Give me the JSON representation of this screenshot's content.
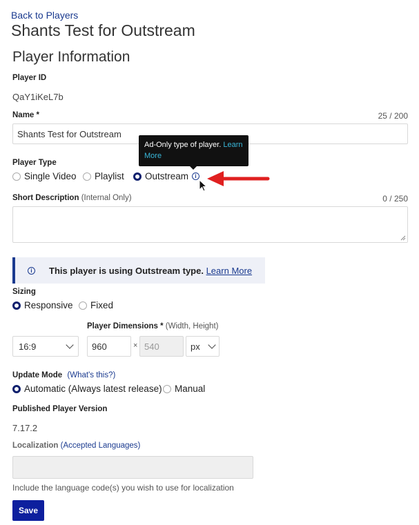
{
  "nav": {
    "back_label": "Back to Players"
  },
  "page": {
    "title": "Shants Test for Outstream",
    "section_title": "Player Information"
  },
  "player_id": {
    "label": "Player ID",
    "value": "QaY1iKeL7b"
  },
  "name": {
    "label": "Name *",
    "counter": "25 / 200",
    "value": "Shants Test for Outstream"
  },
  "player_type": {
    "label": "Player Type",
    "options": [
      "Single Video",
      "Playlist",
      "Outstream"
    ],
    "selected": "Outstream",
    "tooltip_text": "Ad-Only type of player.",
    "tooltip_link": "Learn More"
  },
  "short_description": {
    "label": "Short Description",
    "hint": "(Internal Only)",
    "counter": "0 / 250",
    "value": ""
  },
  "banner": {
    "text": "This player is using Outstream type.",
    "link": "Learn More"
  },
  "sizing": {
    "label": "Sizing",
    "options": [
      "Responsive",
      "Fixed"
    ],
    "selected": "Responsive"
  },
  "dimensions": {
    "label": "Player Dimensions *",
    "hint": "(Width, Height)",
    "aspect_ratio": "16:9",
    "width": "960",
    "separator": "×",
    "height": "540",
    "unit": "px"
  },
  "update_mode": {
    "label": "Update Mode",
    "help_link": "(What's this?)",
    "options": [
      "Automatic (Always latest release)",
      "Manual"
    ],
    "selected": "Automatic (Always latest release)"
  },
  "published_version": {
    "label": "Published Player Version",
    "value": "7.17.2"
  },
  "localization": {
    "label": "Localization",
    "link": "(Accepted Languages)",
    "value": "",
    "help": "Include the language code(s) you wish to use for localization"
  },
  "actions": {
    "save_label": "Save"
  },
  "colors": {
    "primary": "#0d1f9e",
    "link": "#1a3a8f",
    "tooltip_bg": "#111111",
    "tooltip_link": "#39b6d8",
    "arrow": "#e02020"
  }
}
